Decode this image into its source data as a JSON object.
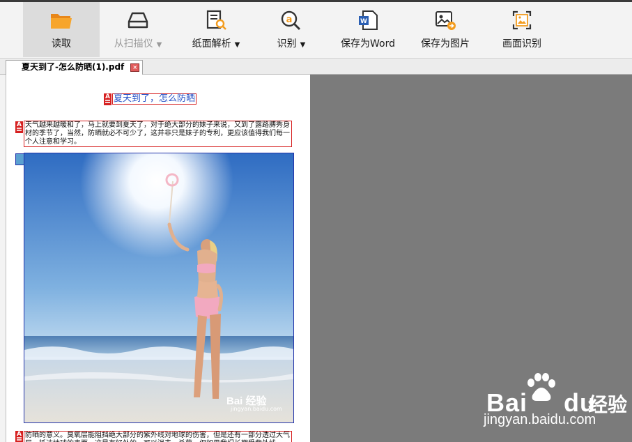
{
  "toolbar": {
    "read": "读取",
    "scan": "从扫描仪",
    "paper_parse": "纸面解析",
    "recognize": "识别",
    "save_word": "保存为Word",
    "save_image": "保存为图片",
    "screen_recognize": "画面识别"
  },
  "tab": {
    "filename": "夏天到了-怎么防晒(1).pdf"
  },
  "document": {
    "title": "夏天到了，怎么防晒",
    "paragraph1": "天气越来越暖和了，马上就要到夏天了，对于绝大部分的妹子来说，又到了露路膊秀身材的季节了，当然，防晒就必不可少了，这并非只是妹子的专利，更应该值得我们每一个人注意和学习。",
    "paragraph2": "防晒的意义。臭氧层能阻挡绝大部分的紫外线对地球的伤害，但是还有一部分透过大气层，抵达地球的表面，这是有好处的，可以消毒、杀菌，但如果我们长期受紫外线",
    "photo_watermark": "Bai 经验",
    "photo_watermark_url": "jingyan.baidu.com"
  },
  "watermark": {
    "brand": "Bai",
    "brand2": "du",
    "cn": "经验",
    "url": "jingyan.baidu.com"
  },
  "colors": {
    "folder": "#f39c1e",
    "annot": "#d62020",
    "title_text": "#2a55c8",
    "viewer_bg": "#7b7b7b"
  }
}
